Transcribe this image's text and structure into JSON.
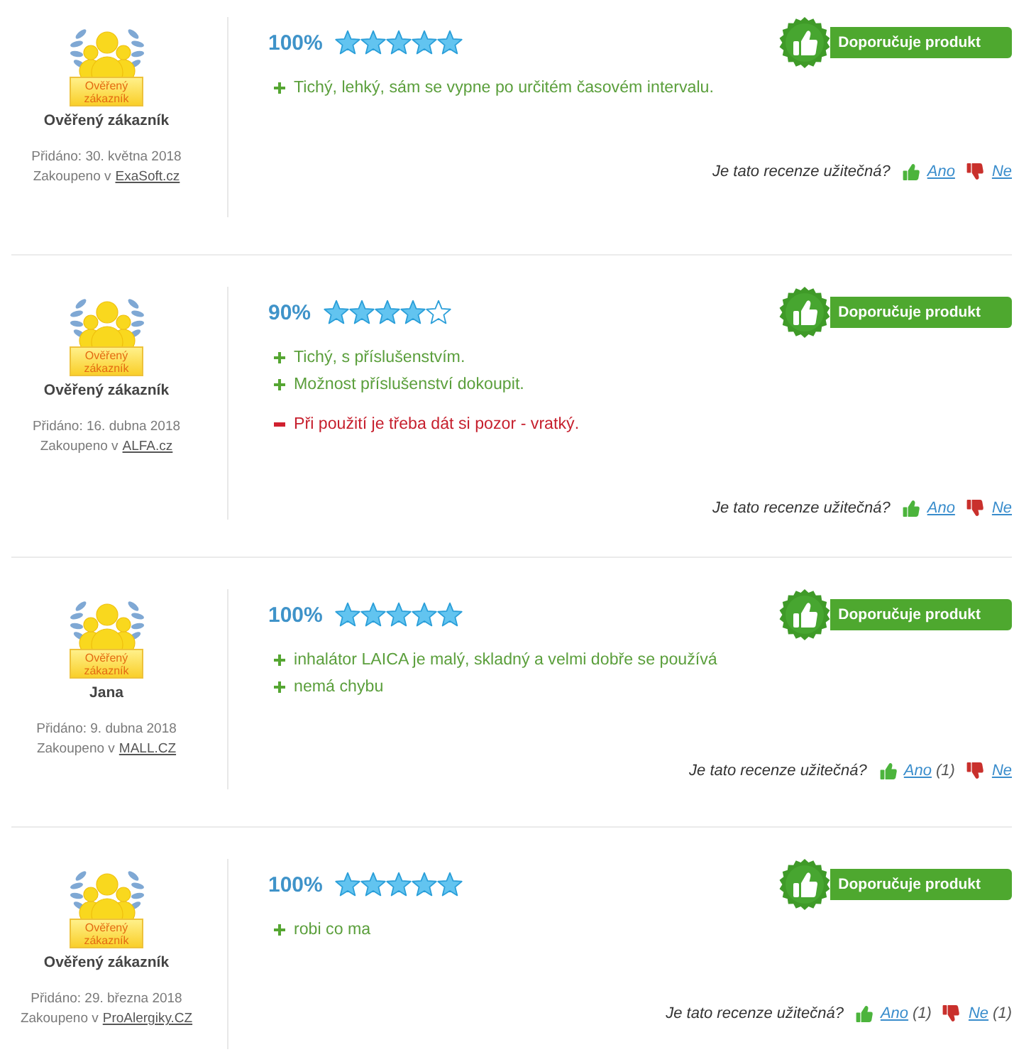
{
  "reviews": [
    {
      "verified_badge": "Ověřený zákazník",
      "author": "Ověřený zákazník",
      "added": "Přidáno: 30. května 2018",
      "purchased_label": "Zakoupeno v",
      "shop": "ExaSoft.cz",
      "score": "100%",
      "stars": 5,
      "recommendation": "Doporučuje produkt",
      "pros": [
        "Tichý, lehký, sám se vypne po určitém časovém intervalu."
      ],
      "helpful": {
        "question": "Je tato recenze užitečná?",
        "yes": "Ano",
        "no": "Ne"
      }
    },
    {
      "verified_badge": "Ověřený zákazník",
      "author": "Ověřený zákazník",
      "added": "Přidáno: 16. dubna 2018",
      "purchased_label": "Zakoupeno v",
      "shop": "ALFA.cz",
      "score": "90%",
      "stars": 4,
      "recommendation": "Doporučuje produkt",
      "pros": [
        "Tichý, s příslušenstvím.",
        "Možnost příslušenství dokoupit."
      ],
      "cons": [
        "Při použití je třeba dát si pozor - vratký."
      ],
      "helpful": {
        "question": "Je tato recenze užitečná?",
        "yes": "Ano",
        "no": "Ne"
      }
    },
    {
      "verified_badge": "Ověřený zákazník",
      "author": "Jana",
      "added": "Přidáno: 9. dubna 2018",
      "purchased_label": "Zakoupeno v",
      "shop": "MALL.CZ",
      "score": "100%",
      "stars": 5,
      "recommendation": "Doporučuje produkt",
      "pros": [
        "inhalátor LAICA je malý, skladný a velmi dobře se používá",
        "nemá chybu"
      ],
      "helpful": {
        "question": "Je tato recenze užitečná?",
        "yes": "Ano",
        "yes_count": "(1)",
        "no": "Ne"
      }
    },
    {
      "verified_badge": "Ověřený zákazník",
      "author": "Ověřený zákazník",
      "added": "Přidáno: 29. března 2018",
      "purchased_label": "Zakoupeno v",
      "shop": "ProAlergiky.CZ",
      "score": "100%",
      "stars": 5,
      "recommendation": "Doporučuje produkt",
      "pros": [
        "robi co ma"
      ],
      "helpful": {
        "question": "Je tato recenze užitečná?",
        "yes": "Ano",
        "yes_count": "(1)",
        "no": "Ne",
        "no_count": "(1)"
      }
    }
  ]
}
